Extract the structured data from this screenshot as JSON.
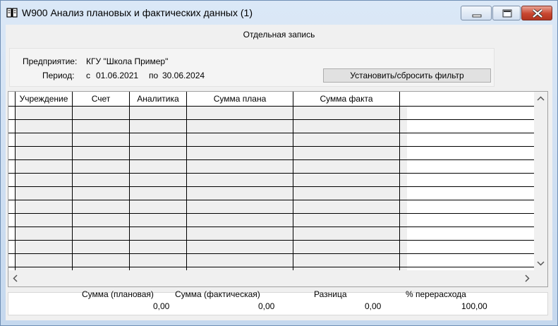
{
  "window": {
    "title": "W900 Анализ плановых и фактических данных (1)",
    "icons": [
      "book-icon",
      "minimize-icon",
      "maximize-icon",
      "close-icon"
    ]
  },
  "caption": "Отдельная запись",
  "filter": {
    "org_label": "Предприятие:",
    "org_value": "КГУ \"Школа Пример\"",
    "period_label": "Период:",
    "from_prefix": "с",
    "from_date": "01.06.2021",
    "to_prefix": "по",
    "to_date": "30.06.2024",
    "button_label": "Установить/сбросить фильтр"
  },
  "grid": {
    "columns": [
      "Учреждение",
      "Счет",
      "Аналитика",
      "Сумма плана",
      "Сумма факта"
    ],
    "rows": []
  },
  "totals": {
    "plan_label": "Сумма (плановая)",
    "plan_value": "0,00",
    "fact_label": "Сумма (фактическая)",
    "fact_value": "0,00",
    "diff_label": "Разница",
    "diff_value": "0,00",
    "over_label": "% перерасхода",
    "over_value": "100,00"
  }
}
